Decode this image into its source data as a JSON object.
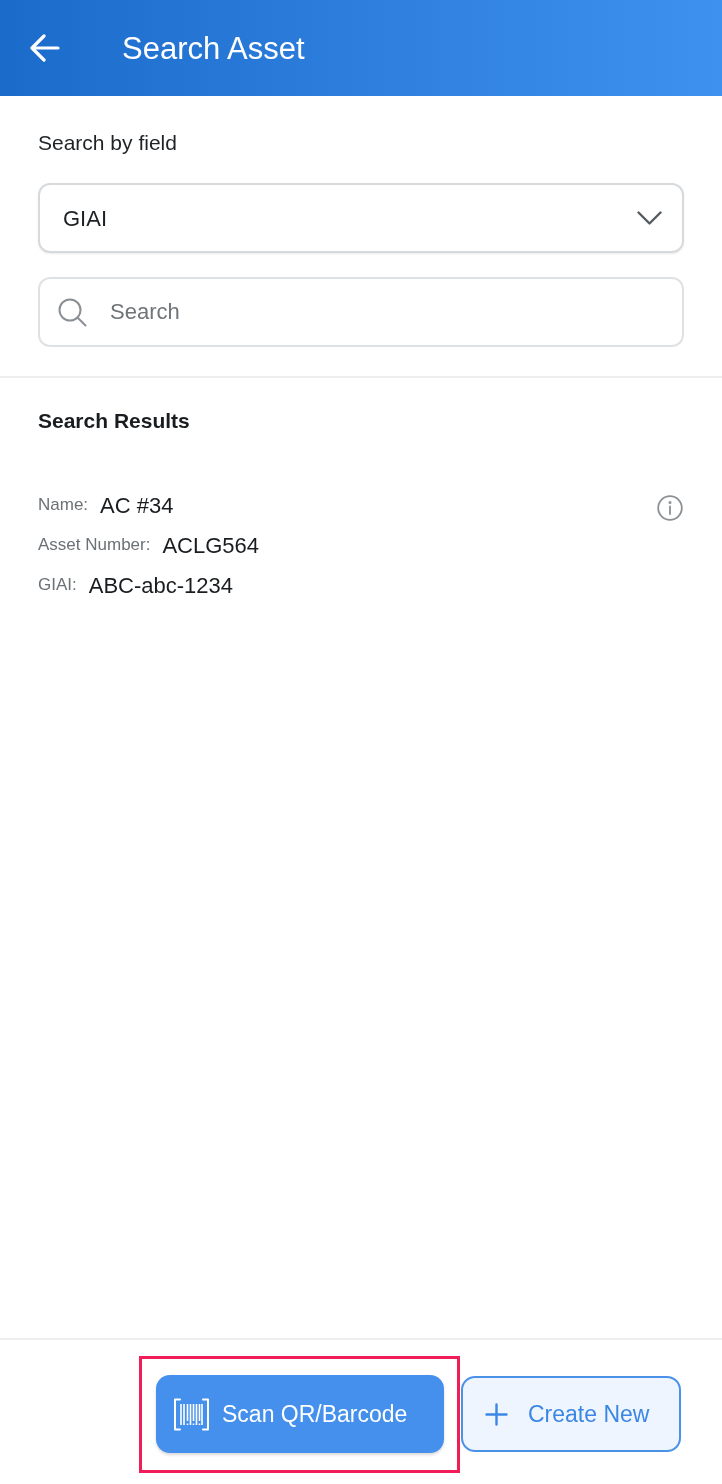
{
  "header": {
    "title": "Search Asset"
  },
  "search_by": {
    "label": "Search by field",
    "dropdown": {
      "value": "GIAI"
    }
  },
  "search_field": {
    "placeholder": "Search"
  },
  "results": {
    "title": "Search Results",
    "items": [
      {
        "fields": [
          {
            "label": "Name:",
            "value": "AC #34"
          },
          {
            "label": "Asset Number:",
            "value": "ACLG564"
          },
          {
            "label": "GIAI:",
            "value": "ABC-abc-1234"
          }
        ]
      }
    ]
  },
  "actions": [
    {
      "kind": "scan",
      "label": "Scan QR/Barcode",
      "highlighted": true
    },
    {
      "kind": "create",
      "label": "Create New",
      "highlighted": false
    }
  ]
}
